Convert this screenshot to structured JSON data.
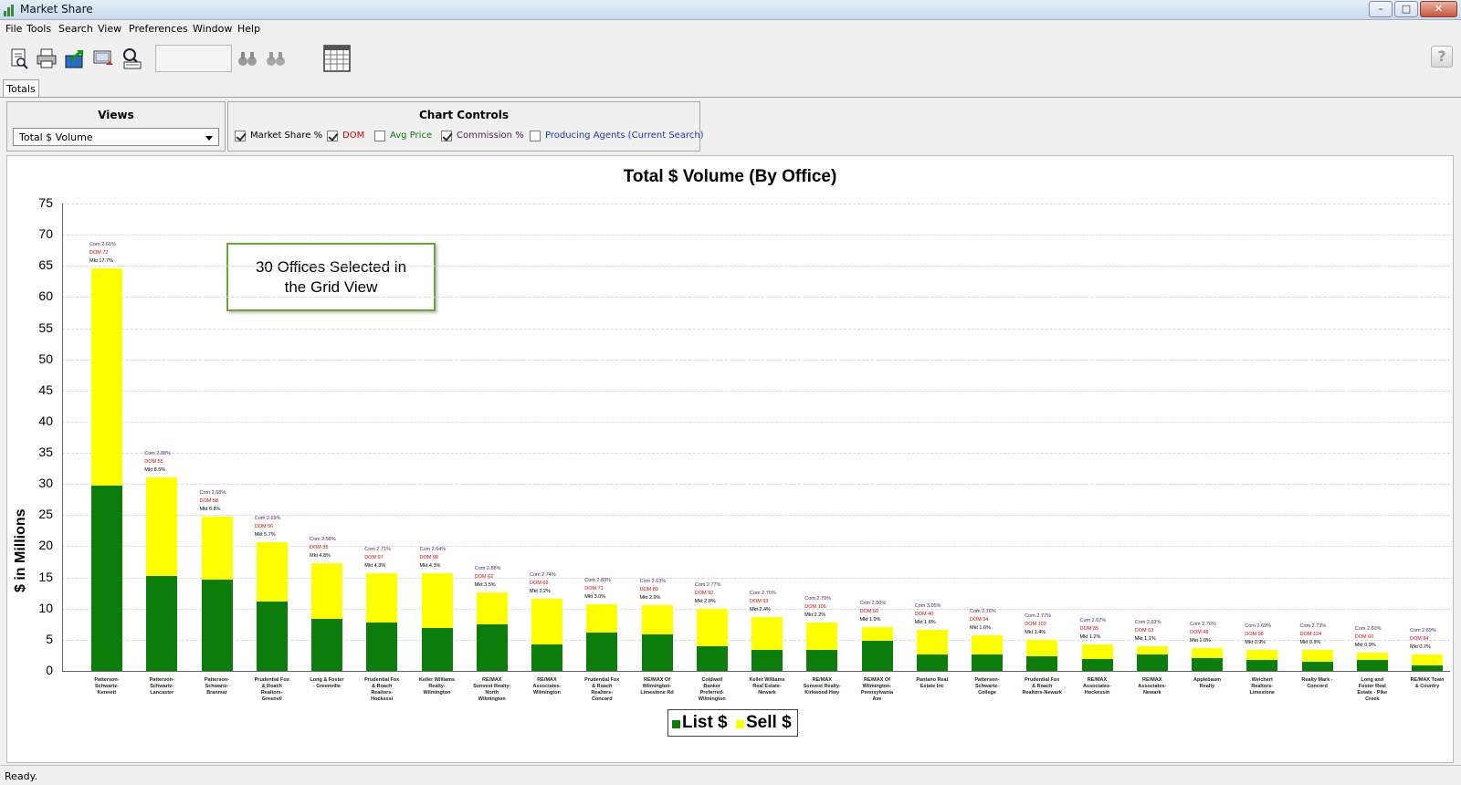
{
  "window": {
    "title": "Market Share"
  },
  "menu": [
    "File",
    "Tools",
    "Search",
    "View",
    "Preferences",
    "Window",
    "Help"
  ],
  "toolbar": {
    "icons": [
      "preview-icon",
      "print-icon",
      "export-icon",
      "send-icon",
      "search-agent-icon",
      "find-icon",
      "find-next-icon",
      "calendar-icon"
    ],
    "search_value": "",
    "help_label": "?"
  },
  "tabs": [
    {
      "label": "Totals",
      "active": true
    }
  ],
  "views": {
    "title": "Views",
    "selected": "Total $ Volume"
  },
  "chart_controls": {
    "title": "Chart Controls",
    "items": [
      {
        "label": "Market Share %",
        "checked": true,
        "color": "#000000"
      },
      {
        "label": "DOM",
        "checked": true,
        "color": "#e00000"
      },
      {
        "label": "Avg Price",
        "checked": false,
        "color": "#0a7d0a"
      },
      {
        "label": "Commission %",
        "checked": true,
        "color": "#551a66"
      },
      {
        "label": "Producing Agents (Current Search)",
        "checked": false,
        "color": "#1a3aa8"
      }
    ]
  },
  "callout": {
    "line1": "30 Offices Selected in",
    "line2": "the Grid View"
  },
  "status": "Ready.",
  "colors": {
    "list": "#0a7d0a",
    "sell": "#ffff00"
  },
  "chart_data": {
    "type": "bar",
    "stacked": true,
    "title": "Total $ Volume (By Office)",
    "xlabel": "",
    "ylabel": "$ in Millions",
    "ylim": [
      0,
      75
    ],
    "yticks": [
      0,
      5,
      10,
      15,
      20,
      25,
      30,
      35,
      40,
      45,
      50,
      55,
      60,
      65,
      70,
      75
    ],
    "grid": true,
    "legend_position": "bottom-center",
    "categories": [
      [
        "Patterson-",
        "Schwartz-",
        "Kennett"
      ],
      [
        "Patterson-",
        "Schwartz-",
        "Lancaster"
      ],
      [
        "Patterson-",
        "Schwartz-",
        "Branmar"
      ],
      [
        "Prudential Fox",
        "& Roach",
        "Realtors-",
        "Greenvil"
      ],
      [
        "Long & Foster",
        "- Greenville"
      ],
      [
        "Prudential Fox",
        "& Roach",
        "Realtors-",
        "Hockessi"
      ],
      [
        "Keller Williams",
        "Realty-",
        "Wilmington"
      ],
      [
        "RE/MAX",
        "Sunvest Realty-",
        "North",
        "Wilmington"
      ],
      [
        "RE/MAX",
        "Associates-",
        "Wilmington"
      ],
      [
        "Prudential Fox",
        "& Roach",
        "Realtors-",
        "Concord"
      ],
      [
        "RE/MAX Of",
        "Wilmington-",
        "Limestone Rd"
      ],
      [
        "Coldwell",
        "Banker",
        "Preferred-",
        "Wilmington"
      ],
      [
        "Keller Williams",
        "Real Estate-",
        "Newark"
      ],
      [
        "RE/MAX",
        "Sunvest Realty-",
        "Kirkwood Hwy"
      ],
      [
        "RE/MAX Of",
        "Wilmington-",
        "Pennsylvania",
        "Ave"
      ],
      [
        "Pantano Real",
        "Estate Inc"
      ],
      [
        "Patterson-",
        "Schwartz-",
        "College"
      ],
      [
        "Prudential Fox",
        "& Roach",
        "Realtors-Newark"
      ],
      [
        "RE/MAX",
        "Associates-",
        "Hockessin"
      ],
      [
        "RE/MAX",
        "Associates-",
        "Newark"
      ],
      [
        "Applebaum",
        "Realty"
      ],
      [
        "Weichert",
        "Realtors-",
        "Limestone"
      ],
      [
        "Realty Mark -",
        "Concord"
      ],
      [
        "Long and",
        "Foster Real",
        "Estate - Pike",
        "Creek"
      ],
      [
        "RE/MAX Town",
        "& Country"
      ]
    ],
    "series": [
      {
        "name": "List $",
        "color": "#0a7d0a",
        "values": [
          29.8,
          15.2,
          14.7,
          11.2,
          8.4,
          7.8,
          6.9,
          7.5,
          4.3,
          6.1,
          5.9,
          3.9,
          3.4,
          3.3,
          4.9,
          2.6,
          2.6,
          2.4,
          1.9,
          2.7,
          2.1,
          1.8,
          1.4,
          1.7,
          0.9
        ]
      },
      {
        "name": "Sell $",
        "color": "#ffff00",
        "values": [
          34.8,
          15.8,
          10.1,
          9.5,
          8.9,
          7.9,
          8.8,
          5.1,
          7.3,
          4.6,
          4.6,
          6.1,
          5.3,
          4.5,
          2.2,
          4.0,
          3.1,
          2.6,
          2.3,
          1.2,
          1.5,
          1.5,
          1.9,
          1.3,
          1.7
        ]
      }
    ],
    "annotations": [
      {
        "com": "Com 2.61%",
        "dom": "DOM 72",
        "mkt": "Mkt 17.7%"
      },
      {
        "com": "Com 2.88%",
        "dom": "DOM 55",
        "mkt": "Mkt 8.5%"
      },
      {
        "com": "Com 2.68%",
        "dom": "DOM 58",
        "mkt": "Mkt 6.8%"
      },
      {
        "com": "Com 2.69%",
        "dom": "DOM 56",
        "mkt": "Mkt 5.7%"
      },
      {
        "com": "Com 2.58%",
        "dom": "DOM 35",
        "mkt": "Mkt 4.8%"
      },
      {
        "com": "Com 2.71%",
        "dom": "DOM 97",
        "mkt": "Mkt 4.3%"
      },
      {
        "com": "Com 2.64%",
        "dom": "DOM 98",
        "mkt": "Mkt 4.3%"
      },
      {
        "com": "Com 2.88%",
        "dom": "DOM 62",
        "mkt": "Mkt 3.5%"
      },
      {
        "com": "Com 2.74%",
        "dom": "DOM 69",
        "mkt": "Mkt 3.2%"
      },
      {
        "com": "Com 2.83%",
        "dom": "DOM 71",
        "mkt": "Mkt 3.0%"
      },
      {
        "com": "Com 2.63%",
        "dom": "DOM 89",
        "mkt": "Mkt 2.9%"
      },
      {
        "com": "Com 2.77%",
        "dom": "DOM 92",
        "mkt": "Mkt 2.8%"
      },
      {
        "com": "Com 2.70%",
        "dom": "DOM 93",
        "mkt": "Mkt 2.4%"
      },
      {
        "com": "Com 2.79%",
        "dom": "DOM 106",
        "mkt": "Mkt 2.2%"
      },
      {
        "com": "Com 2.50%",
        "dom": "DOM 69",
        "mkt": "Mkt 1.9%"
      },
      {
        "com": "Com 3.05%",
        "dom": "DOM 40",
        "mkt": "Mkt 1.8%"
      },
      {
        "com": "Com 2.76%",
        "dom": "DOM 94",
        "mkt": "Mkt 1.6%"
      },
      {
        "com": "Com 2.77%",
        "dom": "DOM 103",
        "mkt": "Mkt 1.4%"
      },
      {
        "com": "Com 2.67%",
        "dom": "DOM 85",
        "mkt": "Mkt 1.2%"
      },
      {
        "com": "Com 2.63%",
        "dom": "DOM 63",
        "mkt": "Mkt 1.1%"
      },
      {
        "com": "Com 2.76%",
        "dom": "DOM 48",
        "mkt": "Mkt 1.0%"
      },
      {
        "com": "Com 2.69%",
        "dom": "DOM 98",
        "mkt": "Mkt 0.9%"
      },
      {
        "com": "Com 2.73%",
        "dom": "DOM 124",
        "mkt": "Mkt 0.9%"
      },
      {
        "com": "Com 2.60%",
        "dom": "DOM 60",
        "mkt": "Mkt 0.9%"
      },
      {
        "com": "Com 2.69%",
        "dom": "DOM 84",
        "mkt": "Mkt 0.7%"
      }
    ]
  }
}
